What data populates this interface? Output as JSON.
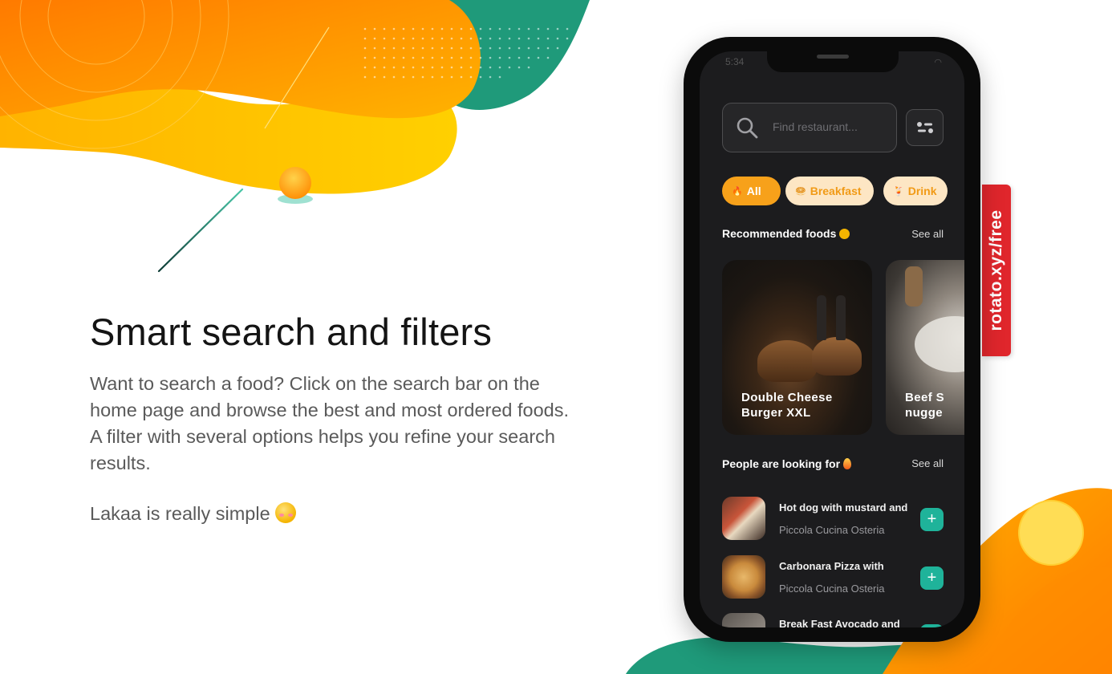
{
  "headline": "Smart search and filters",
  "body": "Want to search a food? Click on the search bar on the home page and browse the best and most ordered foods. A filter with several options helps you refine your search results.",
  "tagline": "Lakaa is really simple",
  "ribbon": "rotato.xyz/free",
  "colors": {
    "accent": "#f7a11a",
    "add_button": "#1fb39a",
    "ribbon": "#e0262c",
    "screen_bg": "#1c1c1e"
  },
  "app": {
    "status_time": "5:34",
    "search": {
      "placeholder": "Find restaurant..."
    },
    "filter_icon": "sliders-icon",
    "chips": [
      {
        "label": "All",
        "icon": "fire-icon"
      },
      {
        "label": "Breakfast",
        "icon": "bread-icon"
      },
      {
        "label": "Drink",
        "icon": "drink-icon"
      }
    ],
    "recommended": {
      "title": "Recommended foods",
      "see_all": "See all",
      "cards": [
        {
          "line1": "Double Cheese",
          "line2": "Burger XXL"
        },
        {
          "line1": "Beef S",
          "line2": "nugge"
        }
      ]
    },
    "looking_for": {
      "title": "People are looking for",
      "see_all": "See all",
      "items": [
        {
          "name": "Hot dog with mustard and",
          "restaurant": "Piccola Cucina Osteria",
          "add": "+"
        },
        {
          "name": "Carbonara Pizza with",
          "restaurant": "Piccola Cucina Osteria",
          "add": "+"
        },
        {
          "name": "Break Fast Avocado and",
          "restaurant": "",
          "add": "+"
        }
      ]
    }
  }
}
